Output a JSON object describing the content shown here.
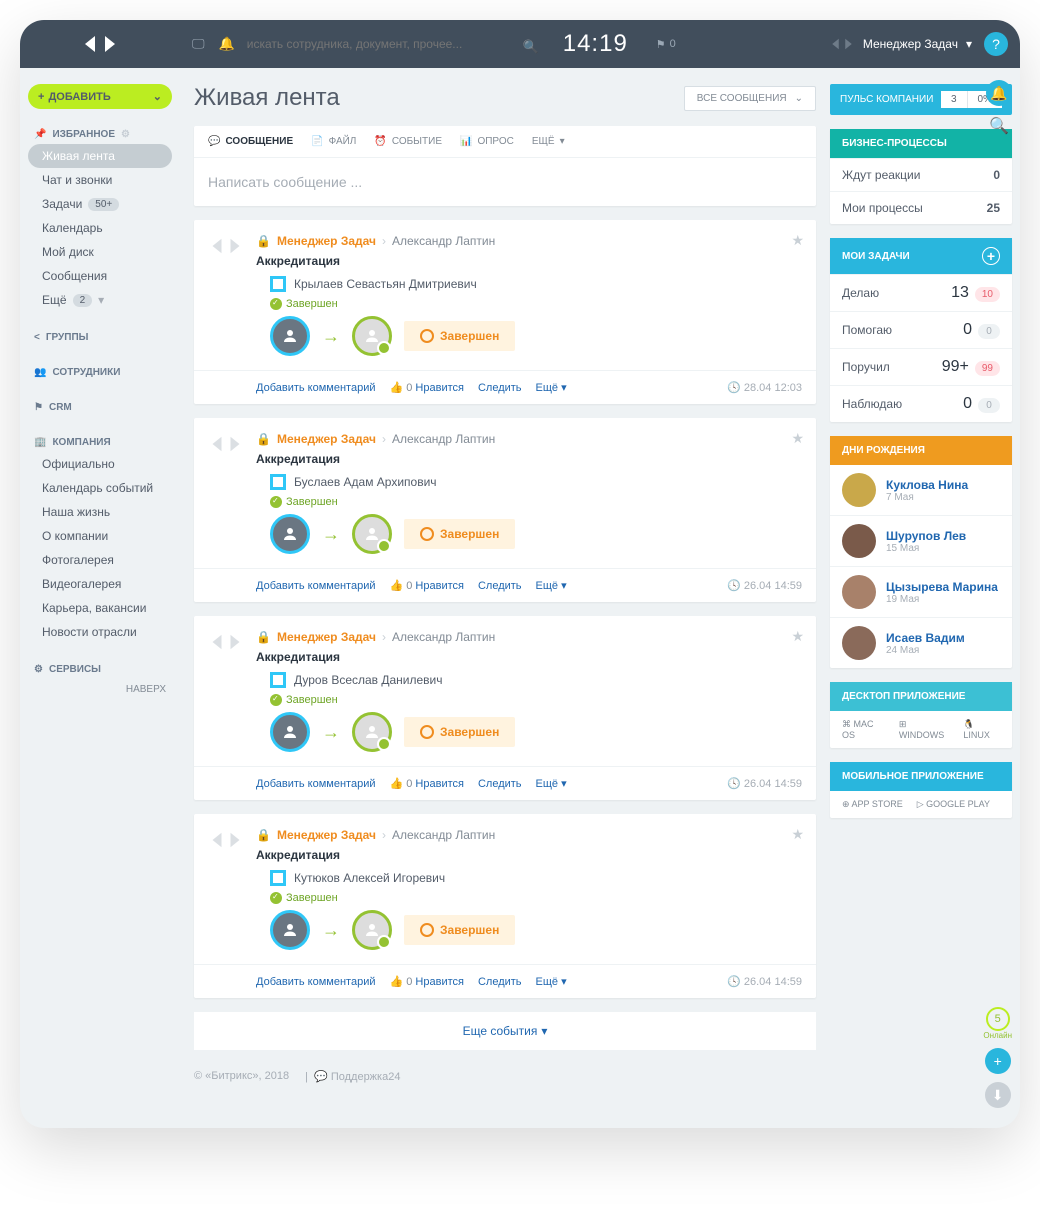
{
  "header": {
    "search_placeholder": "искать сотрудника, документ, прочее...",
    "time": "14:19",
    "notif_count": "0",
    "user_name": "Менеджер Задач"
  },
  "sidebar": {
    "add_label": "ДОБАВИТЬ",
    "favorites_label": "ИЗБРАННОЕ",
    "items_fav": [
      {
        "label": "Живая лента",
        "active": true
      },
      {
        "label": "Чат и звонки"
      },
      {
        "label": "Задачи",
        "badge": "50+"
      },
      {
        "label": "Календарь"
      },
      {
        "label": "Мой диск"
      },
      {
        "label": "Сообщения"
      },
      {
        "label": "Ещё",
        "badge": "2"
      }
    ],
    "groups_label": "ГРУППЫ",
    "employees_label": "СОТРУДНИКИ",
    "crm_label": "CRM",
    "company_label": "КОМПАНИЯ",
    "company_items": [
      "Официально",
      "Календарь событий",
      "Наша жизнь",
      "О компании",
      "Фотогалерея",
      "Видеогалерея",
      "Карьера, вакансии",
      "Новости отрасли"
    ],
    "services_label": "СЕРВИСЫ",
    "up_label": "НАВЕРХ"
  },
  "page": {
    "title": "Живая лента",
    "filter_label": "ВСЕ СООБЩЕНИЯ",
    "tabs": {
      "message": "СООБЩЕНИЕ",
      "file": "ФАЙЛ",
      "event": "СОБЫТИЕ",
      "poll": "ОПРОС",
      "more": "ЕЩЁ"
    },
    "compose_placeholder": "Написать сообщение ...",
    "more_events": "Еще события"
  },
  "posts": [
    {
      "author": "Менеджер Задач",
      "recipient": "Александр Лаптин",
      "title": "Аккредитация",
      "assignee": "Крылаев Севастьян Дмитриевич",
      "status": "Завершен",
      "done": "Завершен",
      "ts": "28.04 12:03"
    },
    {
      "author": "Менеджер Задач",
      "recipient": "Александр Лаптин",
      "title": "Аккредитация",
      "assignee": "Буслаев Адам Архипович",
      "status": "Завершен",
      "done": "Завершен",
      "ts": "26.04 14:59"
    },
    {
      "author": "Менеджер Задач",
      "recipient": "Александр Лаптин",
      "title": "Аккредитация",
      "assignee": "Дуров Всеслав Данилевич",
      "status": "Завершен",
      "done": "Завершен",
      "ts": "26.04 14:59"
    },
    {
      "author": "Менеджер Задач",
      "recipient": "Александр Лаптин",
      "title": "Аккредитация",
      "assignee": "Кутюков Алексей Игоревич",
      "status": "Завершен",
      "done": "Завершен",
      "ts": "26.04 14:59"
    }
  ],
  "post_actions": {
    "comment": "Добавить комментарий",
    "like": "Нравится",
    "like_count": "0",
    "follow": "Следить",
    "more": "Ещё"
  },
  "pulse": {
    "label": "ПУЛЬС КОМПАНИИ",
    "count": "3",
    "pct": "0%"
  },
  "bizproc": {
    "header": "БИЗНЕС-ПРОЦЕССЫ",
    "rows": [
      {
        "label": "Ждут реакции",
        "val": "0"
      },
      {
        "label": "Мои процессы",
        "val": "25"
      }
    ]
  },
  "tasks": {
    "header": "МОИ ЗАДАЧИ",
    "rows": [
      {
        "label": "Делаю",
        "val": "13",
        "pill": "10",
        "red": true
      },
      {
        "label": "Помогаю",
        "val": "0",
        "pill": "0"
      },
      {
        "label": "Поручил",
        "val": "99+",
        "pill": "99",
        "red": true
      },
      {
        "label": "Наблюдаю",
        "val": "0",
        "pill": "0"
      }
    ]
  },
  "birthdays": {
    "header": "ДНИ РОЖДЕНИЯ",
    "people": [
      {
        "name": "Куклова Нина",
        "date": "7 Мая",
        "color": "#c9a84a"
      },
      {
        "name": "Шурупов Лев",
        "date": "15 Мая",
        "color": "#7a5a4a"
      },
      {
        "name": "Цызырева Марина",
        "date": "19 Мая",
        "color": "#a8816a"
      },
      {
        "name": "Исаев Вадим",
        "date": "24 Мая",
        "color": "#8a6a5a"
      }
    ]
  },
  "desktop": {
    "header": "ДЕСКТОП ПРИЛОЖЕНИЕ",
    "items": [
      "MAC OS",
      "WINDOWS",
      "LINUX"
    ]
  },
  "mobile": {
    "header": "МОБИЛЬНОЕ ПРИЛОЖЕНИЕ",
    "items": [
      "APP STORE",
      "GOOGLE PLAY"
    ]
  },
  "footer": {
    "copyright": "© «Битрикс», 2018",
    "support": "Поддержка24"
  },
  "rail": {
    "online_count": "5",
    "online_label": "Онлайн"
  }
}
